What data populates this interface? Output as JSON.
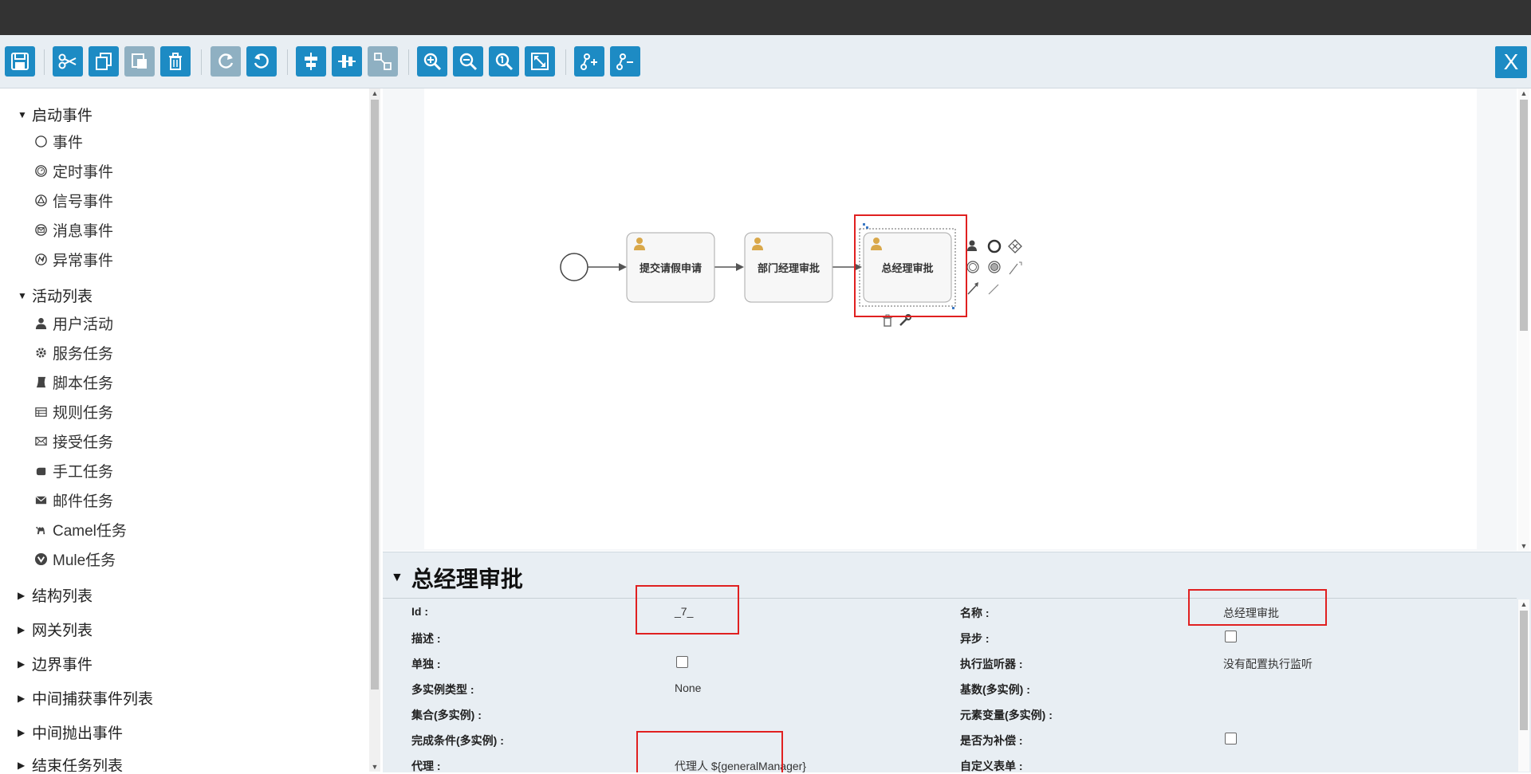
{
  "toolbar": {
    "buttons": [
      {
        "name": "save-button",
        "icon": "save-icon"
      },
      {
        "name": "cut-button",
        "icon": "scissors-icon"
      },
      {
        "name": "copy-button",
        "icon": "copy-icon"
      },
      {
        "name": "paste-button",
        "icon": "paste-icon"
      },
      {
        "name": "delete-button",
        "icon": "trash-icon"
      },
      {
        "name": "redo-button",
        "icon": "redo-icon"
      },
      {
        "name": "undo-button",
        "icon": "undo-icon"
      },
      {
        "name": "align-horizontal-button",
        "icon": "align-horizontal-icon"
      },
      {
        "name": "align-vertical-button",
        "icon": "align-vertical-icon"
      },
      {
        "name": "same-size-button",
        "icon": "same-size-icon"
      },
      {
        "name": "zoom-in-button",
        "icon": "zoom-in-icon"
      },
      {
        "name": "zoom-out-button",
        "icon": "zoom-out-icon"
      },
      {
        "name": "zoom-actual-button",
        "icon": "zoom-actual-icon"
      },
      {
        "name": "zoom-fit-button",
        "icon": "zoom-fit-icon"
      },
      {
        "name": "add-bendpoint-button",
        "icon": "add-bendpoint-icon"
      },
      {
        "name": "remove-bendpoint-button",
        "icon": "remove-bendpoint-icon"
      }
    ],
    "close_label": "X"
  },
  "palette": {
    "groups": [
      {
        "label": "启动事件",
        "expanded": true,
        "items": [
          {
            "label": "事件",
            "icon": "circle-icon"
          },
          {
            "label": "定时事件",
            "icon": "timer-icon"
          },
          {
            "label": "信号事件",
            "icon": "signal-icon"
          },
          {
            "label": "消息事件",
            "icon": "message-icon"
          },
          {
            "label": "异常事件",
            "icon": "error-icon"
          }
        ]
      },
      {
        "label": "活动列表",
        "expanded": true,
        "items": [
          {
            "label": "用户活动",
            "icon": "user-icon"
          },
          {
            "label": "服务任务",
            "icon": "gear-icon"
          },
          {
            "label": "脚本任务",
            "icon": "script-icon"
          },
          {
            "label": "规则任务",
            "icon": "table-icon"
          },
          {
            "label": "接受任务",
            "icon": "envelope-icon"
          },
          {
            "label": "手工任务",
            "icon": "hand-icon"
          },
          {
            "label": "邮件任务",
            "icon": "envelope-filled-icon"
          },
          {
            "label": "Camel任务",
            "icon": "camel-icon"
          },
          {
            "label": "Mule任务",
            "icon": "mule-icon"
          }
        ]
      },
      {
        "label": "结构列表",
        "expanded": false,
        "items": []
      },
      {
        "label": "网关列表",
        "expanded": false,
        "items": []
      },
      {
        "label": "边界事件",
        "expanded": false,
        "items": []
      },
      {
        "label": "中间捕获事件列表",
        "expanded": false,
        "items": []
      },
      {
        "label": "中间抛出事件",
        "expanded": false,
        "items": []
      },
      {
        "label": "结束任务列表",
        "expanded": false,
        "items": []
      }
    ]
  },
  "diagram": {
    "tasks": [
      {
        "label": "提交请假申请",
        "icon": "user-icon"
      },
      {
        "label": "部门经理审批",
        "icon": "user-icon"
      },
      {
        "label": "总经理审批",
        "icon": "user-icon",
        "selected": true
      }
    ]
  },
  "properties": {
    "title": "总经理审批",
    "rows": [
      {
        "left_label": "Id :",
        "left_value": "_7_",
        "right_label": "名称 :",
        "right_value": "总经理审批"
      },
      {
        "left_label": "描述 :",
        "left_value": "",
        "right_label": "异步 :",
        "right_checkbox": true
      },
      {
        "left_label": "单独 :",
        "left_checkbox": true,
        "right_label": "执行监听器 :",
        "right_value": "没有配置执行监听"
      },
      {
        "left_label": "多实例类型 :",
        "left_value": "None",
        "right_label": "基数(多实例) :",
        "right_value": ""
      },
      {
        "left_label": "集合(多实例) :",
        "left_value": "",
        "right_label": "元素变量(多实例) :",
        "right_value": ""
      },
      {
        "left_label": "完成条件(多实例) :",
        "left_value": "",
        "right_label": "是否为补偿 :",
        "right_checkbox": true
      },
      {
        "left_label": "代理 :",
        "left_value": "代理人 ${generalManager}",
        "right_label": "自定义表单 :",
        "right_value": ""
      }
    ]
  },
  "colors": {
    "accent": "#1d8bc4",
    "highlight": "#e02020",
    "topbar": "#333333"
  }
}
